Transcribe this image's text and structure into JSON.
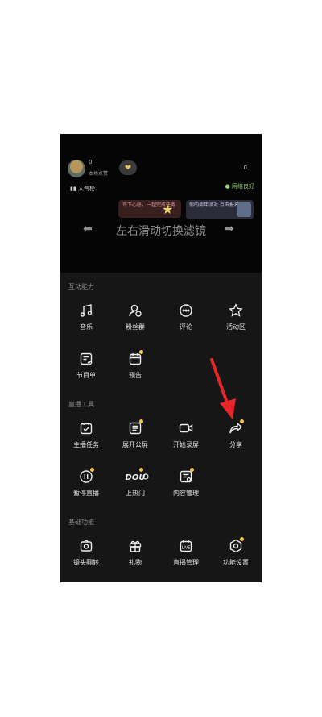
{
  "live": {
    "viewer_count": "0",
    "viewer_sub": "本场点赞",
    "right_count": "0",
    "network": "网络良好",
    "rank_label": "人气榜",
    "banner1": "许下心愿，一起完成任务",
    "banner2": "你的周年派对 点击报名",
    "filter_hint": "左右滑动切换滤镜"
  },
  "sections": {
    "interaction": "互动能力",
    "tools": "直播工具",
    "basic": "基础功能"
  },
  "interaction_items": [
    {
      "label": "音乐",
      "icon": "music-icon",
      "dot": false
    },
    {
      "label": "粉丝群",
      "icon": "fans-group-icon",
      "dot": false
    },
    {
      "label": "评论",
      "icon": "comment-icon",
      "dot": false
    },
    {
      "label": "活动区",
      "icon": "star-icon",
      "dot": false
    },
    {
      "label": "节目单",
      "icon": "program-list-icon",
      "dot": false
    },
    {
      "label": "预告",
      "icon": "calendar-icon",
      "dot": true
    }
  ],
  "tool_items": [
    {
      "label": "主播任务",
      "icon": "task-icon",
      "dot": false
    },
    {
      "label": "展开公屏",
      "icon": "screen-icon",
      "dot": true
    },
    {
      "label": "开始录屏",
      "icon": "record-icon",
      "dot": false
    },
    {
      "label": "分享",
      "icon": "share-icon",
      "dot": true
    },
    {
      "label": "暂停直播",
      "icon": "pause-icon",
      "dot": true
    },
    {
      "label": "上热门",
      "icon": "dou-plus-icon",
      "dot": true
    },
    {
      "label": "内容管理",
      "icon": "content-manage-icon",
      "dot": true
    }
  ],
  "basic_items": [
    {
      "label": "镜头翻转",
      "icon": "camera-flip-icon",
      "dot": false
    },
    {
      "label": "礼物",
      "icon": "gift-icon",
      "dot": false
    },
    {
      "label": "直播管理",
      "icon": "live-manage-icon",
      "dot": false
    },
    {
      "label": "功能设置",
      "icon": "settings-icon",
      "dot": true
    }
  ],
  "colors": {
    "panel_bg": "#161616",
    "dot": "#f6c54f",
    "annotation": "#e8262a"
  }
}
